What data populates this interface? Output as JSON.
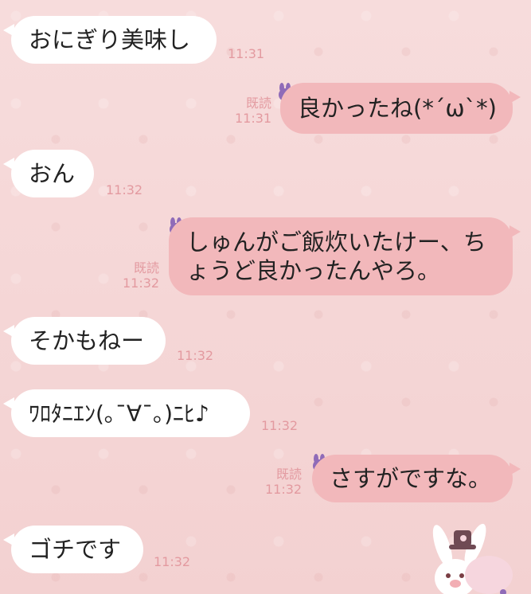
{
  "messages": [
    {
      "side": "left",
      "text": "おにぎり美味し",
      "time": "11:31"
    },
    {
      "side": "right",
      "text": "良かったね(*´ω`*)",
      "time": "11:31",
      "read": "既読",
      "icon": "bunny-icon"
    },
    {
      "side": "left",
      "text": "おん",
      "time": "11:32"
    },
    {
      "side": "right",
      "text": "しゅんがご飯炊いたけー、ちょうど良かったんやろ。",
      "line1": "しゅんがご飯炊いたけー、ち",
      "line2": "ょうど良かったんやろ。",
      "time": "11:32",
      "read": "既読",
      "icon": "bunny-icon"
    },
    {
      "side": "left",
      "text": "そかもねー",
      "time": "11:32"
    },
    {
      "side": "left",
      "text": "ﾜﾛﾀﾆｴﾝ(｡¯∀¯｡)ﾆﾋ♪",
      "time": "11:32"
    },
    {
      "side": "right",
      "text": "さすがですな。",
      "time": "11:32",
      "read": "既読",
      "icon": "bunny-icon"
    },
    {
      "side": "left",
      "text": "ゴチです",
      "time": "11:32"
    }
  ],
  "colors": {
    "background": "#f6d8d8",
    "right_bubble": "#f2b8bb",
    "left_bubble": "#ffffff",
    "meta": "#e39aa0",
    "bunny": "#8f6bb8"
  }
}
